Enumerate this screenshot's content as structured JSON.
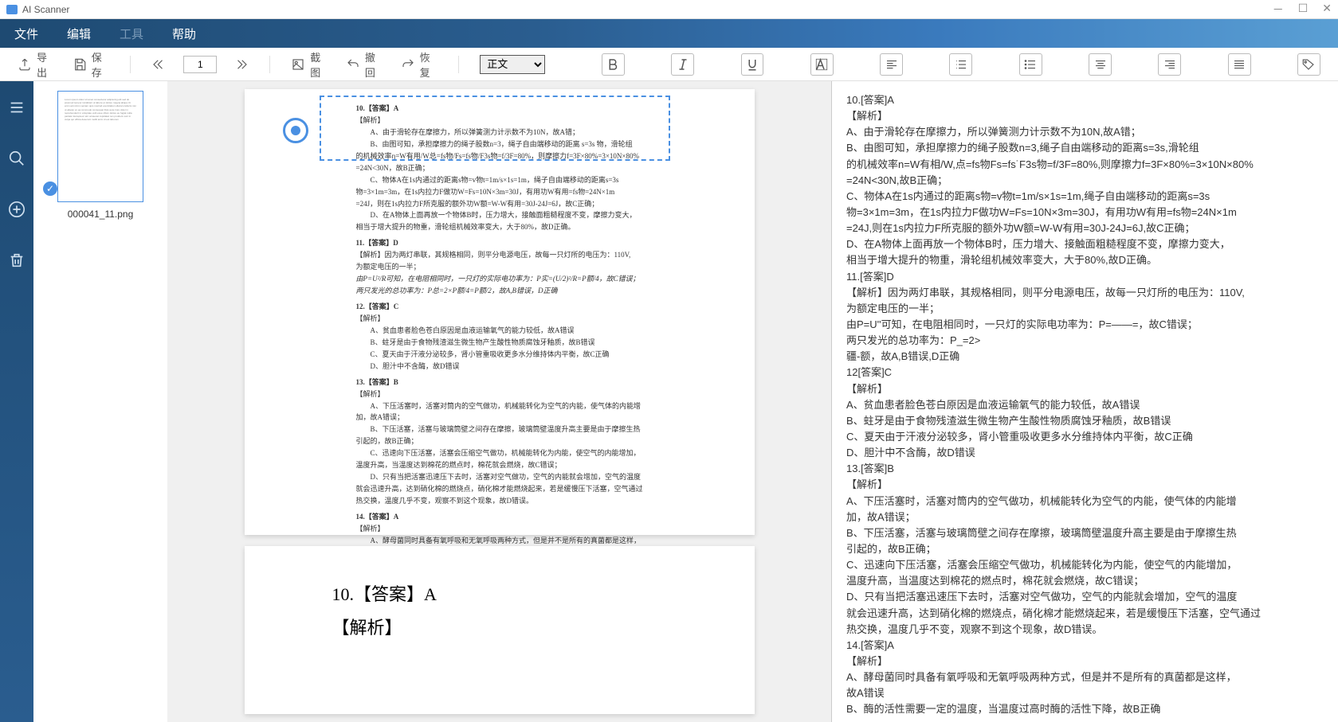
{
  "window": {
    "title": "AI Scanner"
  },
  "menubar": {
    "file": "文件",
    "edit": "编辑",
    "tools": "工具",
    "help": "帮助"
  },
  "toolbar": {
    "export": "导出",
    "save": "保存",
    "page_num": "1",
    "crop": "截图",
    "undo": "撤回",
    "redo": "恢复",
    "style_value": "正文"
  },
  "thumbnail": {
    "filename": "000041_11.png"
  },
  "doc_page1": {
    "q10": {
      "head": "10.【答案】A",
      "jiexi": "【解析】",
      "a": "A、由于滑轮存在摩擦力，所以弹簧测力计示数不为10N，故A错；",
      "b1": "B、由图可知，承担摩擦力的绳子股数n=3，绳子自由端移动的距离 s=3s 物，滑轮组",
      "b2": "的机械效率η=W有用/W总=fs物/Fs=fs物/F3s物=f/3F=80%，则摩擦力f=3F×80%=3×10N×80%",
      "b3": "=24N<30N，故B正确；",
      "c1": "C、物体A在1s内通过的距离s物=v物t=1m/s×1s=1m，绳子自由端移动的距离s=3s",
      "c2": "物=3×1m=3m，在1s内拉力F做功W=Fs=10N×3m=30J，有用功W有用=fs物=24N×1m",
      "c3": "=24J，则在1s内拉力F所克服的额外功W额=W-W有用=30J-24J=6J，故C正确；",
      "d1": "D、在A物体上面再放一个物体B时，压力增大，接触面粗糙程度不变，摩擦力变大，",
      "d2": "相当于增大提升的物重，滑轮组机械效率变大，大于80%，故D正确。"
    },
    "q11": {
      "head": "11.【答案】D",
      "l1": "【解析】因为两灯串联，其规格相同，则平分电源电压，故每一只灯所的电压为：110V,",
      "l2": "为额定电压的一半；",
      "l3": "由P=U²/R可知，在电阻相同时，一只灯的实际电功率为：P实=(U/2)²/R=P额/4，故C错误；",
      "l4": "两只发光的总功率为：P总=2×P额/4=P额/2，故A,B错误，D正确"
    },
    "q12": {
      "head": "12.【答案】C",
      "jiexi": "【解析】",
      "a": "A、贫血患者脸色苍白原因是血液运输氧气的能力较低，故A错误",
      "b": "B、蛀牙是由于食物残渣滋生微生物产生酸性物质腐蚀牙釉质，故B错误",
      "c": "C、夏天由于汗液分泌较多，肾小管重吸收更多水分维持体内平衡，故C正确",
      "d": "D、胆汁中不含酶，故D错误"
    },
    "q13": {
      "head": "13.【答案】B",
      "jiexi": "【解析】",
      "a1": "A、下压活塞时，活塞对筒内的空气做功，机械能转化为空气的内能，使气体的内能增",
      "a2": "加，故A错误；",
      "b1": "B、下压活塞，活塞与玻璃筒壁之间存在摩擦，玻璃筒壁温度升高主要是由于摩擦生热",
      "b2": "引起的，故B正确；",
      "c1": "C、迅速向下压活塞，活塞会压缩空气做功，机械能转化为内能，使空气的内能增加，",
      "c2": "温度升高，当温度达到棉花的燃点时，棉花就会燃烧，故C错误；",
      "d1": "D、只有当把活塞迅速压下去时，活塞对空气做功，空气的内能就会增加，空气的温度",
      "d2": "就会迅速升高，达到硝化棉的燃烧点，硝化棉才能燃烧起来，若是缓慢压下活塞，空气通过",
      "d3": "热交换，温度几乎不变，观察不到这个现象，故D错误。"
    },
    "q14": {
      "head": "14.【答案】A",
      "jiexi": "【解析】",
      "a1": "A、酵母菌同时具备有氧呼吸和无氧呼吸两种方式，但是并不是所有的真菌都是这样，",
      "a2": "故A错误",
      "b": "B、酶的活性需要一定的温度，当温度过高时酶的活性下降，故B正确"
    }
  },
  "doc_page2": {
    "l1": "10.【答案】A",
    "l2": "【解析】"
  },
  "ocr_text": "10.[答案]A\n【解析】\nA、由于滑轮存在摩擦力，所以弹簧测力计示数不为10N,故A错；\nB、由图可知，承担摩擦力的绳子股数n=3,绳子自由端移动的距离s=3s,滑轮组\n的机械效率n=W有相/W,点=fs物Fs=fs˙F3s物=f/3F=80%,则摩擦力f=3F×80%=3×10N×80%\n=24N<30N,故B正确；\nC、物体A在1s内通过的距离s物=v物t=1m/s×1s=1m,绳子自由端移动的距离s=3s\n物=3×1m=3m，在1s内拉力F做功W=Fs=10N×3m=30J，有用功W有用=fs物=24N×1m\n=24J,则在1s内拉力F所克服的额外功W额=W-W有用=30J-24J=6J,故C正确；\nD、在A物体上面再放一个物体B时，压力增大、接触面粗糙程度不变，摩擦力变大，\n相当于增大提升的物重，滑轮组机械效率变大，大于80%,故D正确。\n11.[答案]D\n【解析】因为两灯串联，其规格相同，则平分电源电压，故每一只灯所的电压为：110V,\n为额定电压的一半；\n由P=U''可知，在电阻相同时，一只灯的实际电功率为：P=——=，故C错误；\n两只发光的总功率为：P_=2>\n疆-额，故A,B错误,D正确\n12[答案]C\n【解析】\nA、贫血患者脸色苍白原因是血液运输氧气的能力较低，故A错误\nB、蛀牙是由于食物残渣滋生微生物产生酸性物质腐蚀牙釉质，故B错误\nC、夏天由于汗液分泌较多，肾小管重吸收更多水分维持体内平衡，故C正确\nD、胆汁中不含酶，故D错误\n13.[答案]B\n【解析】\nA、下压活塞时，活塞对筒内的空气做功，机械能转化为空气的内能，使气体的内能增\n加，故A错误；\nB、下压活塞，活塞与玻璃筒壁之间存在摩擦，玻璃筒壁温度升高主要是由于摩擦生热\n引起的，故B正确；\nC、迅速向下压活塞，活塞会压缩空气做功，机械能转化为内能，使空气的内能增加，\n温度升高，当温度达到棉花的燃点时，棉花就会燃烧，故C错误；\nD、只有当把活塞迅速压下去时，活塞对空气做功，空气的内能就会增加，空气的温度\n就会迅速升高，达到硝化棉的燃烧点，硝化棉才能燃烧起来，若是缓慢压下活塞，空气通过\n热交换，温度几乎不变，观察不到这个现象，故D错误。\n14.[答案]A\n【解析】\nA、酵母菌同时具备有氧呼吸和无氧呼吸两种方式，但是并不是所有的真菌都是这样，\n故A错误\nB、酶的活性需要一定的温度，当温度过高时酶的活性下降，故B正确"
}
